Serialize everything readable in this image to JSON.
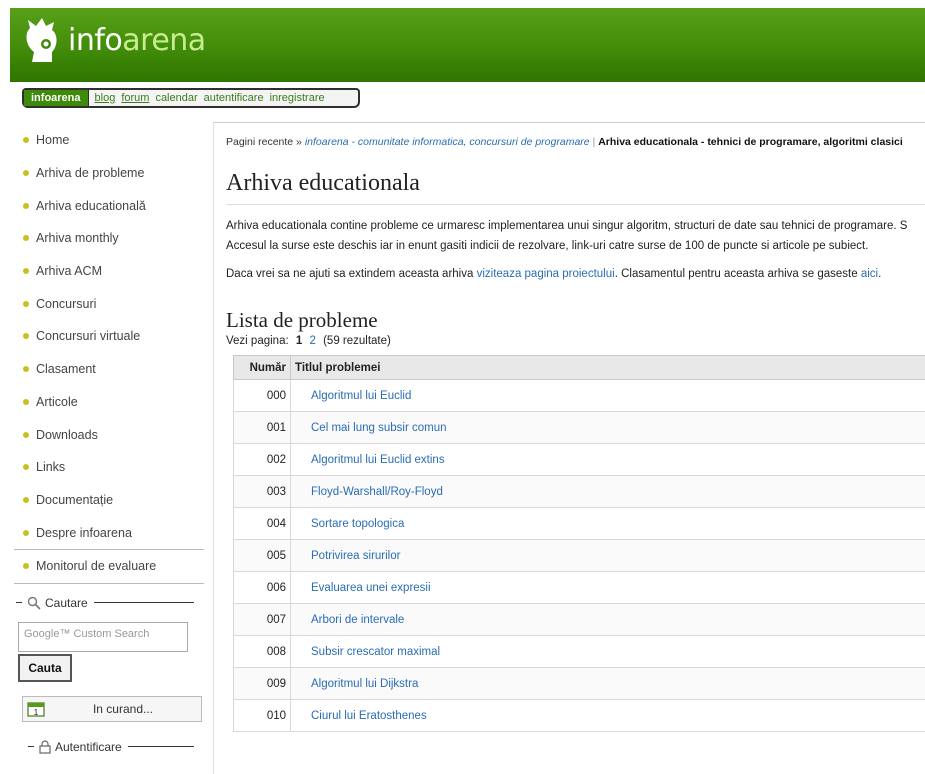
{
  "header": {
    "logo_text_1": "info",
    "logo_text_2": "arena"
  },
  "topnav": {
    "active": "infoarena",
    "links": [
      "blog",
      "forum",
      "calendar",
      "autentificare",
      "inregistrare"
    ]
  },
  "sidebar": {
    "items": [
      {
        "label": "Home"
      },
      {
        "label": "Arhiva de probleme"
      },
      {
        "label": "Arhiva educatională"
      },
      {
        "label": "Arhiva monthly"
      },
      {
        "label": "Arhiva ACM"
      },
      {
        "label": "Concursuri"
      },
      {
        "label": "Concursuri virtuale"
      },
      {
        "label": "Clasament"
      },
      {
        "label": "Articole"
      },
      {
        "label": "Downloads"
      },
      {
        "label": "Links"
      },
      {
        "label": "Documentație"
      },
      {
        "label": "Despre infoarena"
      },
      {
        "label": "Monitorul de evaluare"
      }
    ],
    "search_legend": "Cautare",
    "search_placeholder": "Google™ Custom Search",
    "search_button": "Cauta",
    "soon_label": "In curand...",
    "auth_legend": "Autentificare",
    "calendar_day": "1"
  },
  "main": {
    "breadcrumb_prefix": "Pagini recente »",
    "breadcrumb_link": "infoarena - comunitate informatica, concursuri de programare",
    "breadcrumb_sep": "|",
    "breadcrumb_current": "Arhiva educationala - tehnici de programare, algoritmi clasici",
    "title": "Arhiva educationala",
    "para1_line1": "Arhiva educationala contine probleme ce urmaresc implementarea unui singur algoritm, structuri de date sau tehnici de programare. S",
    "para1_line2": "Accesul la surse este deschis iar in enunt gasiti indicii de rezolvare, link-uri catre surse de 100 de puncte si articole pe subiect.",
    "para2_prefix": "Daca vrei sa ne ajuti sa extindem aceasta arhiva",
    "para2_link1": "viziteaza pagina proiectului",
    "para2_mid": ". Clasamentul pentru aceasta arhiva se gaseste",
    "para2_link2": "aici",
    "para2_suffix": ".",
    "list_title": "Lista de probleme",
    "pager_label": "Vezi pagina:",
    "pager_current": "1",
    "pager_next": "2",
    "pager_results": "(59 rezultate)",
    "table_headers": {
      "num": "Număr",
      "title": "Titlul problemei"
    },
    "rows": [
      {
        "num": "000",
        "title": "Algoritmul lui Euclid"
      },
      {
        "num": "001",
        "title": "Cel mai lung subsir comun"
      },
      {
        "num": "002",
        "title": "Algoritmul lui Euclid extins"
      },
      {
        "num": "003",
        "title": "Floyd-Warshall/Roy-Floyd"
      },
      {
        "num": "004",
        "title": "Sortare topologica"
      },
      {
        "num": "005",
        "title": "Potrivirea sirurilor"
      },
      {
        "num": "006",
        "title": "Evaluarea unei expresii"
      },
      {
        "num": "007",
        "title": "Arbori de intervale"
      },
      {
        "num": "008",
        "title": "Subsir crescator maximal"
      },
      {
        "num": "009",
        "title": "Algoritmul lui Dijkstra"
      },
      {
        "num": "010",
        "title": "Ciurul lui Eratosthenes"
      }
    ]
  },
  "colors": {
    "brand_green": "#3f8a08",
    "link_blue": "#2a6db3",
    "bullet": "#c8c020"
  }
}
